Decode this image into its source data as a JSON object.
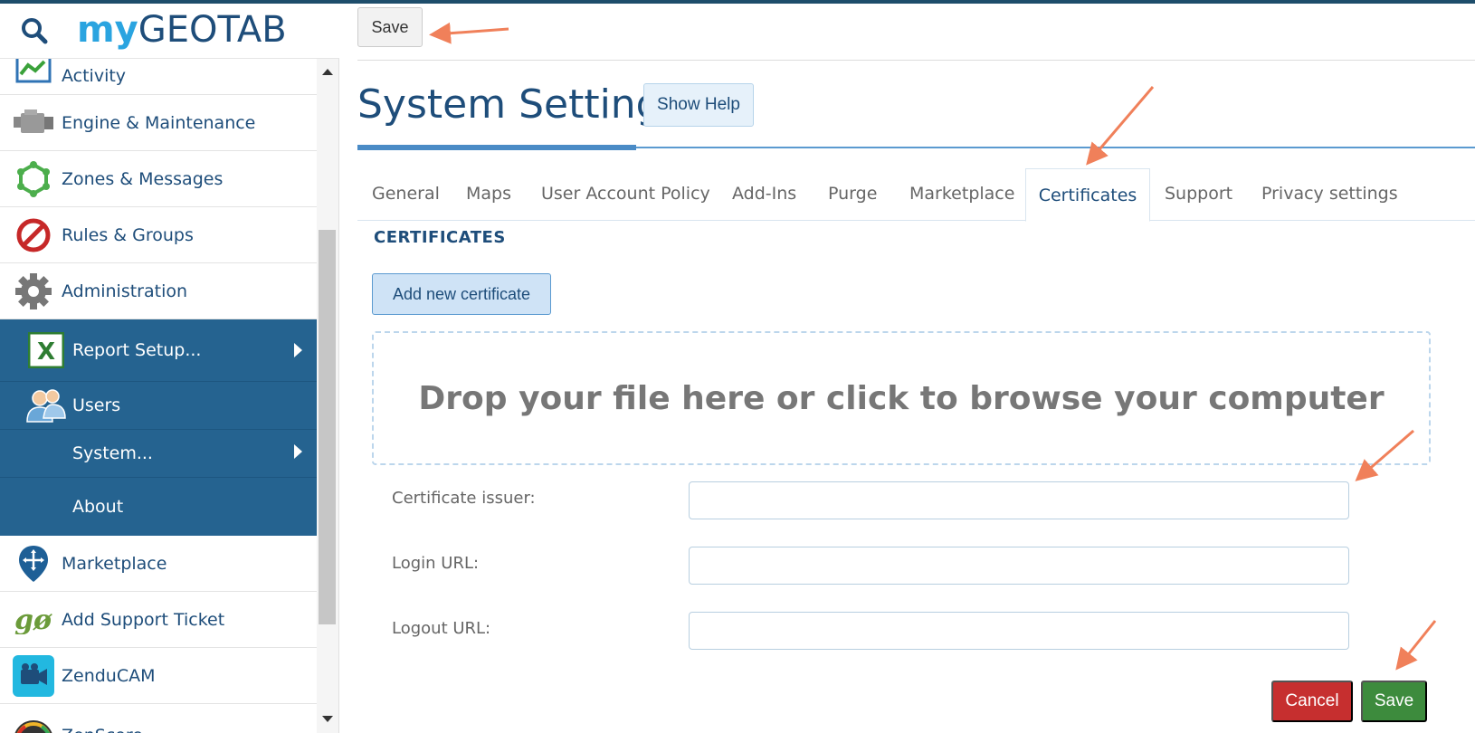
{
  "brand": {
    "my": "my",
    "geotab": "GEOTAB"
  },
  "sidebar": {
    "items": [
      {
        "label": "Activity",
        "icon": "activity-icon"
      },
      {
        "label": "Engine & Maintenance",
        "icon": "engine-icon"
      },
      {
        "label": "Zones & Messages",
        "icon": "zones-icon"
      },
      {
        "label": "Rules & Groups",
        "icon": "rules-icon"
      },
      {
        "label": "Administration",
        "icon": "gear-icon"
      }
    ],
    "submenu": [
      {
        "label": "Report Setup...",
        "icon": "excel-icon",
        "has_arrow": true
      },
      {
        "label": "Users",
        "icon": "users-icon",
        "has_arrow": false
      },
      {
        "label": "System...",
        "has_arrow": true
      },
      {
        "label": "About",
        "has_arrow": false
      }
    ],
    "items_after": [
      {
        "label": "Marketplace",
        "icon": "marketplace-icon"
      },
      {
        "label": "Add Support Ticket",
        "icon": "go-icon"
      },
      {
        "label": "ZenduCAM",
        "icon": "camera-icon"
      },
      {
        "label": "ZenScore",
        "icon": "gauge-icon"
      }
    ]
  },
  "toolbar": {
    "save_label": "Save"
  },
  "page": {
    "title": "System Settings",
    "help_label": "Show Help"
  },
  "tabs": [
    {
      "label": "General"
    },
    {
      "label": "Maps"
    },
    {
      "label": "User Account Policy"
    },
    {
      "label": "Add-Ins"
    },
    {
      "label": "Purge"
    },
    {
      "label": "Marketplace"
    },
    {
      "label": "Certificates",
      "active": true
    },
    {
      "label": "Support"
    },
    {
      "label": "Privacy settings"
    }
  ],
  "certificates": {
    "section_title": "CERTIFICATES",
    "add_label": "Add new certificate",
    "dropzone_text": "Drop your file here or click to browse your computer",
    "fields": [
      {
        "label": "Certificate issuer:",
        "value": ""
      },
      {
        "label": "Login URL:",
        "value": ""
      },
      {
        "label": "Logout URL:",
        "value": ""
      }
    ]
  },
  "actions": {
    "cancel_label": "Cancel",
    "save_label": "Save"
  },
  "colors": {
    "brand_dark": "#1e4d7a",
    "brand_light": "#2aa4e0",
    "submenu_bg": "#256390",
    "cancel": "#c62f2f",
    "save": "#3d8b3d",
    "annotation_arrow": "#f0805a"
  }
}
